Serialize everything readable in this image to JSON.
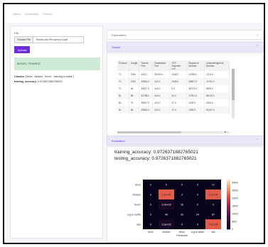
{
  "nav": {
    "items": [
      "Home",
      "Dashboard",
      "Predict"
    ]
  },
  "left": {
    "file_title": "File",
    "choose_label": "Choose File",
    "file_name": "Thesis and Pre survey d.pdf",
    "upload_label": "Upload",
    "trained_label": "MODEL TRAINED",
    "classes_label": "Classes:",
    "classes_value": "['drive', 'intokes', 'bever', 'warning to settle']",
    "training_label": "training_accuracy:",
    "training_value": "0.9726371882765021"
  },
  "right": {
    "parameters_label": "Parameters",
    "output_label": "Output",
    "evaluation_label": "Evaluation",
    "training_accuracy_text": "training_accuracy: 0.9726371882765021",
    "testing_accuracy_text": "testing_accuracy: 0.9726371882765021"
  },
  "table": {
    "headers": [
      "Protocol",
      "Length",
      "Source Port",
      "Destination Port",
      "TCP Segment Len",
      "Sequence Number",
      "Acknowledgment Number"
    ],
    "rows": [
      [
        "TL",
        "1394",
        "443.0",
        "39419.0",
        "1348.0",
        "14788.0",
        "1213.0"
      ],
      [
        "TL",
        "1394",
        "39815.0",
        "443.0",
        "1348.0",
        "28607.0",
        "11751.0"
      ],
      [
        "TL",
        "54",
        "39817.0",
        "443.0",
        "0.0",
        "48713.0",
        "8903.0"
      ],
      [
        "BL",
        "68",
        "52758.0",
        "443.0",
        "22.0",
        "17291.0",
        "86722.0"
      ],
      [
        "BL",
        "74",
        "39817.0",
        "443.0",
        "17.0",
        "1025.0",
        "2091.0"
      ],
      [
        "BL",
        "66",
        "39818.0",
        "443.0",
        "17.0",
        "1083.0",
        "51047.0"
      ]
    ]
  },
  "chart_data": {
    "type": "heatmap",
    "ylabels": [
      "drive",
      "intokes",
      "bever",
      "w.g.to settle",
      "idle"
    ],
    "xlabels": [
      "drive",
      "intokes",
      "bever",
      "w.g.to settle",
      "idle"
    ],
    "xlabel": "Predicted",
    "values": [
      [
        2,
        0,
        0,
        0,
        17
      ],
      [
        0,
        22000,
        2,
        0,
        22000
      ],
      [
        0,
        2000,
        16,
        0,
        0
      ],
      [
        0,
        40,
        32,
        24,
        87
      ],
      [
        0,
        2000,
        0,
        0,
        22000
      ]
    ],
    "labels": [
      [
        "2",
        "0",
        "0",
        "0",
        "17"
      ],
      [
        "0",
        "2.2e+04",
        "2",
        "0",
        "2.2e+04"
      ],
      [
        "0",
        "2.0e+03",
        "16",
        "0",
        "0"
      ],
      [
        "0",
        "40",
        "32",
        "24",
        "87"
      ],
      [
        "0",
        "2.0e+03",
        "0",
        "0",
        "2.2e+04"
      ]
    ],
    "colorbar_ticks": [
      "30000",
      "25000",
      "20000",
      "15000",
      "10000",
      "5000",
      "0"
    ],
    "vmin": 0,
    "vmax": 32000
  }
}
